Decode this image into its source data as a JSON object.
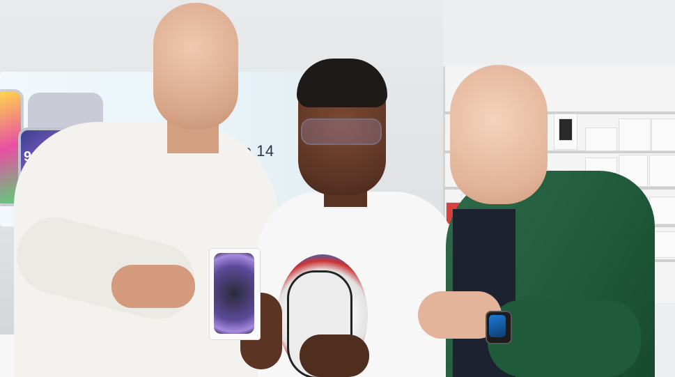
{
  "scene": {
    "screen_label": "ne 14",
    "phone_time": "9:41"
  },
  "colors": {
    "shirt_green": "#1f5a3a",
    "shirt_white": "#f3f2ee",
    "box_screen": "#5b4a9a",
    "wall": "#e8eaec"
  }
}
